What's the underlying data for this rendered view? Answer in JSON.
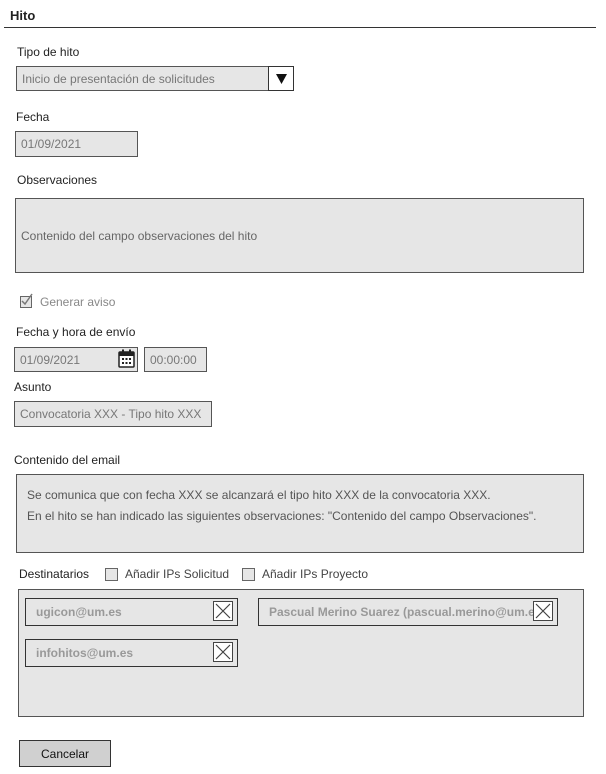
{
  "header": {
    "title": "Hito"
  },
  "tipo_hito": {
    "label": "Tipo de hito",
    "value": "Inicio de presentación de solicitudes",
    "dropdown_icon": "triangle-down-icon"
  },
  "fecha": {
    "label": "Fecha",
    "value": "01/09/2021"
  },
  "observaciones": {
    "label": "Observaciones",
    "value": "Contenido del campo observaciones del hito"
  },
  "generar_aviso": {
    "label": "Generar aviso",
    "checked": true
  },
  "envio": {
    "label": "Fecha y hora de envío",
    "date": "01/09/2021",
    "time": "00:00:00",
    "calendar_icon": "calendar-icon"
  },
  "asunto": {
    "label": "Asunto",
    "value": "Convocatoria XXX - Tipo hito XXX"
  },
  "contenido_email": {
    "label": "Contenido del email",
    "line1": "Se comunica que con fecha XXX se alcanzará el tipo hito XXX de la convocatoria XXX.",
    "line2": "En el hito se han indicado las siguientes observaciones: \"Contenido del campo Observaciones\"."
  },
  "destinatarios": {
    "label": "Destinatarios",
    "add_ips_solicitud": "Añadir IPs Solicitud",
    "add_ips_proyecto": "Añadir IPs Proyecto",
    "recipients": [
      "ugicon@um.es",
      "Pascual Merino Suarez (pascual.merino@um.es)",
      "infohitos@um.es"
    ]
  },
  "actions": {
    "cancel_label": "Cancelar"
  }
}
